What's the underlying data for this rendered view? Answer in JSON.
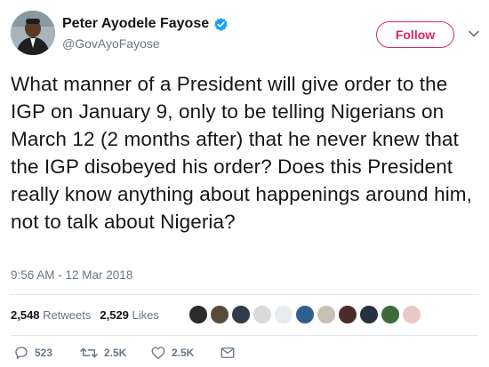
{
  "author": {
    "name": "Peter Ayodele Fayose",
    "handle": "@GovAyoFayose",
    "verified": true
  },
  "follow_label": "Follow",
  "tweet": {
    "text": "What manner of a President will give order to the IGP on January 9, only to be telling Nigerians on March 12 (2 months after) that he never knew that the IGP disobeyed his order? Does this President really know anything about happenings around him, not to talk about Nigeria?",
    "timestamp": "9:56 AM - 12 Mar 2018"
  },
  "stats": {
    "retweets_count": "2,548",
    "retweets_label": "Retweets",
    "likes_count": "2,529",
    "likes_label": "Likes"
  },
  "actions": {
    "reply_count": "523",
    "retweet_count": "2.5K",
    "like_count": "2.5K"
  },
  "colors": {
    "accent": "#e0245e",
    "verified": "#1da1f2",
    "muted": "#657786",
    "divider": "#e1e8ed"
  },
  "liker_avatar_colors": [
    "#2b2b2b",
    "#5a4a3a",
    "#303c48",
    "#d9d9d9",
    "#e8ecef",
    "#2f5f8f",
    "#c9c0b4",
    "#4a2c2a",
    "#24323f",
    "#3f6b3a",
    "#e9c9c8"
  ]
}
